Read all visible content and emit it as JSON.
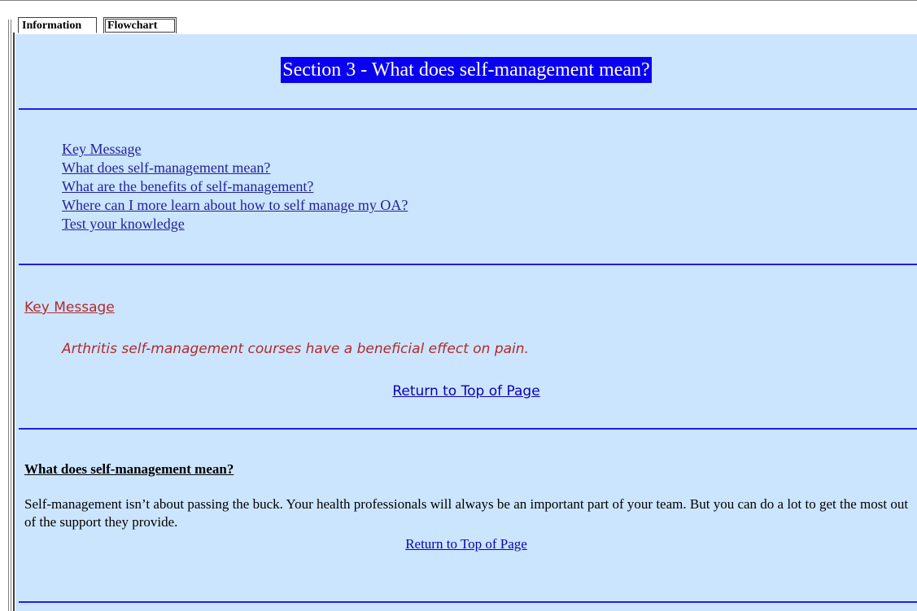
{
  "tabs": [
    {
      "label": "Information",
      "active": true
    },
    {
      "label": "Flowchart",
      "active": false
    }
  ],
  "page": {
    "title": "Section 3 - What does self-management mean?",
    "colors": {
      "background": "#cce5ff",
      "title_bg": "#0a00f0",
      "title_text": "#ffffff",
      "rule": "#1d1ef0",
      "link": "#22229b",
      "key_message": "#b02b2b"
    }
  },
  "toc": {
    "items": [
      "Key Message",
      "What does self-management mean?",
      "What are the benefits of self-management?",
      "Where can I more learn about how to self manage my OA?",
      "Test your knowledge"
    ]
  },
  "key_message": {
    "heading": "Key Message",
    "text": "Arthritis self-management courses have a beneficial effect on pain.",
    "return_link": "Return to Top of Page"
  },
  "section_meaning": {
    "heading": "What does self-management mean?",
    "body": "Self-management isn’t about passing the buck. Your health professionals will always be an important part of your team. But you can do a lot to get the most out of the support they provide.",
    "return_link": "Return to Top of Page"
  }
}
